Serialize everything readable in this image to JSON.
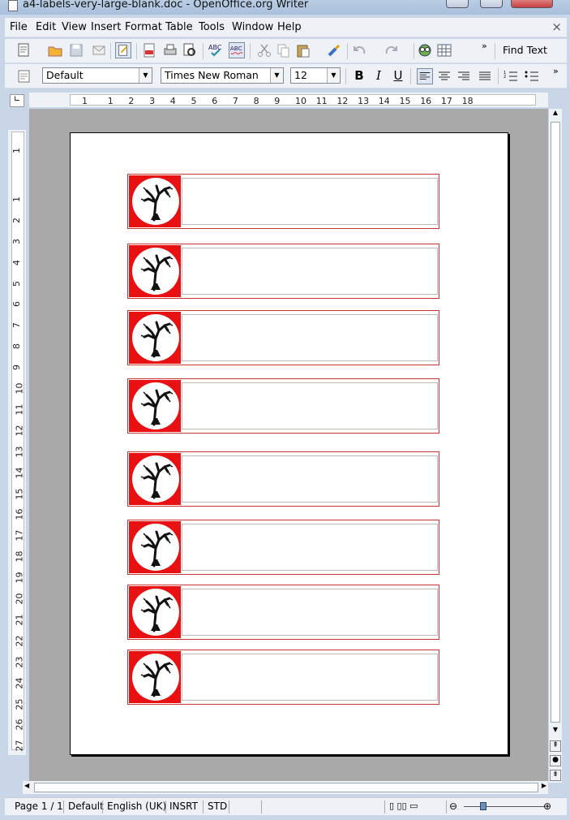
{
  "window": {
    "title": "a4-labels-very-large-blank.doc - OpenOffice.org Writer"
  },
  "menu": {
    "items": [
      "File",
      "Edit",
      "View",
      "Insert",
      "Format",
      "Table",
      "Tools",
      "Window",
      "Help"
    ],
    "close_glyph": "×"
  },
  "toolbar_standard": {
    "find_text": "Find Text"
  },
  "toolbar_format": {
    "style": "Default",
    "font": "Times New Roman",
    "size": "12",
    "bold": "B",
    "italic": "I",
    "underline": "U"
  },
  "ruler_h": {
    "numbers": [
      "1",
      "1",
      "2",
      "3",
      "4",
      "5",
      "6",
      "7",
      "8",
      "9",
      "10",
      "11",
      "12",
      "13",
      "14",
      "15",
      "16",
      "17",
      "18"
    ]
  },
  "ruler_v": {
    "numbers": [
      "1",
      "1",
      "2",
      "3",
      "4",
      "5",
      "6",
      "7",
      "8",
      "9",
      "10",
      "11",
      "12",
      "13",
      "14",
      "15",
      "16",
      "17",
      "18",
      "19",
      "20",
      "21",
      "22",
      "23",
      "24",
      "25",
      "26",
      "27"
    ]
  },
  "labels": {
    "count": 8
  },
  "status": {
    "page": "Page 1 / 1",
    "style": "Default",
    "language": "English (UK)",
    "insert_mode": "INSRT",
    "selection_mode": "STD"
  },
  "colors": {
    "label_accent": "#e81010",
    "workspace": "#a9a9a9"
  }
}
